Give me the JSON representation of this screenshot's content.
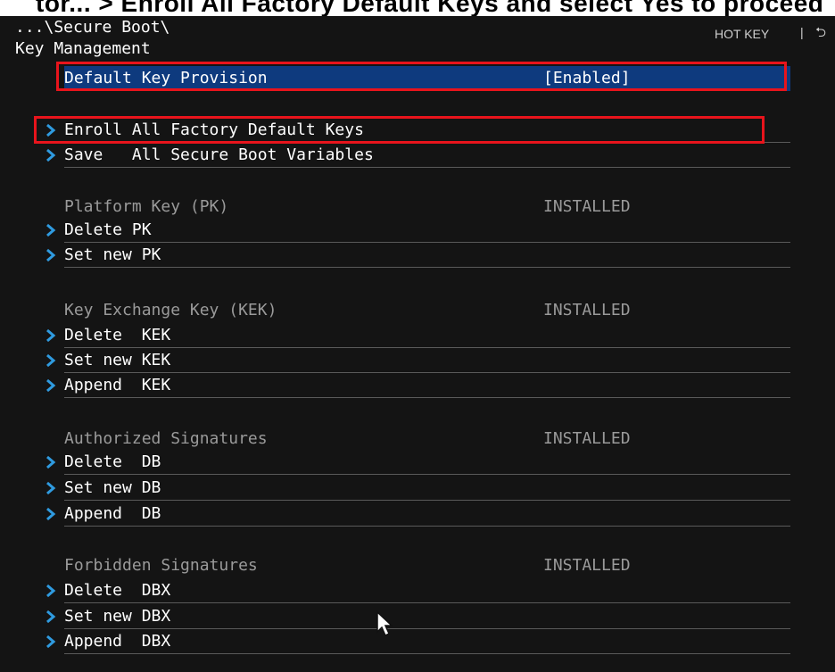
{
  "top_caption": "tor... > Enroll All Factory Default Keys and select Yes to proceed",
  "path": "...\\Secure Boot\\",
  "section_title": "Key Management",
  "hotkey": {
    "label": "HOT KEY",
    "separator": "|",
    "back_icon": "back-arrow-icon"
  },
  "items": [
    {
      "label": "Default Key Provision",
      "value": "[Enabled]"
    },
    {
      "label": "Enroll All Factory Default Keys"
    },
    {
      "label": "Save   All Secure Boot Variables"
    },
    {
      "label": "Platform Key (PK)",
      "value": "INSTALLED"
    },
    {
      "label": "Delete PK"
    },
    {
      "label": "Set new PK"
    },
    {
      "label": "Key Exchange Key (KEK)",
      "value": "INSTALLED"
    },
    {
      "label": "Delete  KEK"
    },
    {
      "label": "Set new KEK"
    },
    {
      "label": "Append  KEK"
    },
    {
      "label": "Authorized Signatures",
      "value": "INSTALLED"
    },
    {
      "label": "Delete  DB"
    },
    {
      "label": "Set new DB"
    },
    {
      "label": "Append  DB"
    },
    {
      "label": "Forbidden Signatures",
      "value": "INSTALLED"
    },
    {
      "label": "Delete  DBX"
    },
    {
      "label": "Set new DBX"
    },
    {
      "label": "Append  DBX"
    }
  ],
  "colors": {
    "selection": "#0e3a7e",
    "highlight_box": "#e8141c",
    "arrow": "#2f9be0"
  }
}
